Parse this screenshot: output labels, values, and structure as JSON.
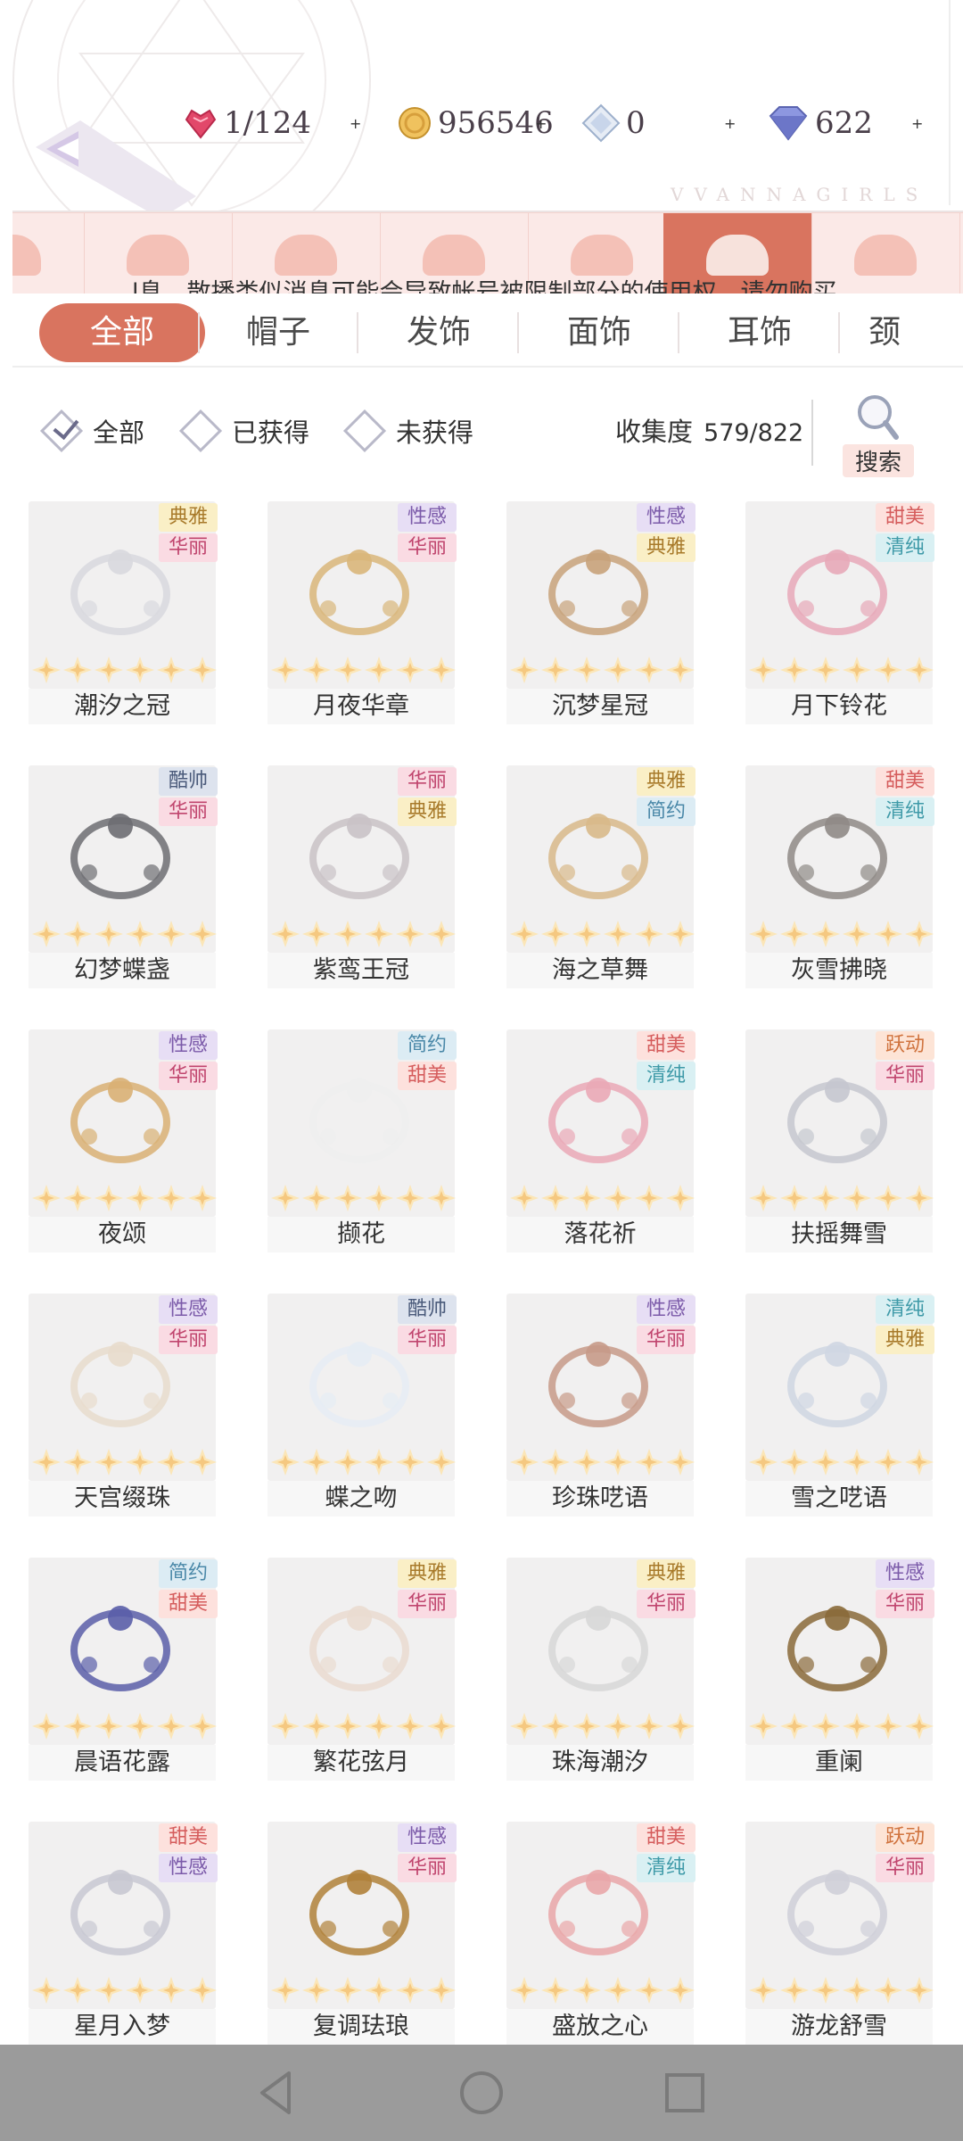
{
  "resources": [
    {
      "name": "stamina",
      "value": "1/124",
      "icon": "heart-gem-icon",
      "color": "#e2486a"
    },
    {
      "name": "gold",
      "value": "956546",
      "icon": "gold-coin-icon",
      "color": "#e9b650"
    },
    {
      "name": "crystal",
      "value": "0",
      "icon": "crystal-icon",
      "color": "#9db0cc"
    },
    {
      "name": "diamond",
      "value": "622",
      "icon": "diamond-icon",
      "color": "#6c76c8"
    }
  ],
  "plus_label": "+",
  "brand": "VVANNAGIRLS",
  "notice": "l息，散播类似消息可能会导致帐号被限制部分的使用权。请勿购买",
  "tabs": [
    "全部",
    "帽子",
    "发饰",
    "面饰",
    "耳饰",
    "颈"
  ],
  "filters": [
    "全部",
    "已获得",
    "未获得"
  ],
  "collection": {
    "label": "收集度",
    "value": "579/822"
  },
  "search_label": "搜索",
  "tag_colors": {
    "典雅": {
      "bg": "#faefc6",
      "fg": "#a87a2a"
    },
    "华丽": {
      "bg": "#fadbe3",
      "fg": "#c0456e"
    },
    "性感": {
      "bg": "#e7def5",
      "fg": "#7b5aa9"
    },
    "甜美": {
      "bg": "#fde1dd",
      "fg": "#d55c5c"
    },
    "清纯": {
      "bg": "#d9f0f3",
      "fg": "#3f9aa8"
    },
    "酷帅": {
      "bg": "#dde3ee",
      "fg": "#4a5a7a"
    },
    "简约": {
      "bg": "#dcecf4",
      "fg": "#4a88a8"
    },
    "跃动": {
      "bg": "#fde4d6",
      "fg": "#d0733e"
    }
  },
  "items": [
    {
      "name": "潮汐之冠",
      "tags": [
        "典雅",
        "华丽"
      ],
      "stars": 6
    },
    {
      "name": "月夜华章",
      "tags": [
        "性感",
        "华丽"
      ],
      "stars": 6
    },
    {
      "name": "沉梦星冠",
      "tags": [
        "性感",
        "典雅"
      ],
      "stars": 6
    },
    {
      "name": "月下铃花",
      "tags": [
        "甜美",
        "清纯"
      ],
      "stars": 6
    },
    {
      "name": "幻梦蝶盏",
      "tags": [
        "酷帅",
        "华丽"
      ],
      "stars": 6
    },
    {
      "name": "紫鸾王冠",
      "tags": [
        "华丽",
        "典雅"
      ],
      "stars": 6
    },
    {
      "name": "海之草舞",
      "tags": [
        "典雅",
        "简约"
      ],
      "stars": 6
    },
    {
      "name": "灰雪拂晓",
      "tags": [
        "甜美",
        "清纯"
      ],
      "stars": 6
    },
    {
      "name": "夜颂",
      "tags": [
        "性感",
        "华丽"
      ],
      "stars": 6
    },
    {
      "name": "撷花",
      "tags": [
        "简约",
        "甜美"
      ],
      "stars": 6
    },
    {
      "name": "落花祈",
      "tags": [
        "甜美",
        "清纯"
      ],
      "stars": 6
    },
    {
      "name": "扶摇舞雪",
      "tags": [
        "跃动",
        "华丽"
      ],
      "stars": 6
    },
    {
      "name": "天宫缀珠",
      "tags": [
        "性感",
        "华丽"
      ],
      "stars": 6
    },
    {
      "name": "蝶之吻",
      "tags": [
        "酷帅",
        "华丽"
      ],
      "stars": 6
    },
    {
      "name": "珍珠呓语",
      "tags": [
        "性感",
        "华丽"
      ],
      "stars": 6
    },
    {
      "name": "雪之呓语",
      "tags": [
        "清纯",
        "典雅"
      ],
      "stars": 6
    },
    {
      "name": "晨语花露",
      "tags": [
        "简约",
        "甜美"
      ],
      "stars": 6
    },
    {
      "name": "繁花弦月",
      "tags": [
        "典雅",
        "华丽"
      ],
      "stars": 6
    },
    {
      "name": "珠海潮汐",
      "tags": [
        "典雅",
        "华丽"
      ],
      "stars": 6
    },
    {
      "name": "重阑",
      "tags": [
        "性感",
        "华丽"
      ],
      "stars": 6
    },
    {
      "name": "星月入梦",
      "tags": [
        "甜美",
        "性感"
      ],
      "stars": 6
    },
    {
      "name": "复调珐琅",
      "tags": [
        "性感",
        "华丽"
      ],
      "stars": 6
    },
    {
      "name": "盛放之心",
      "tags": [
        "甜美",
        "清纯"
      ],
      "stars": 6
    },
    {
      "name": "游龙舒雪",
      "tags": [
        "跃动",
        "华丽"
      ],
      "stars": 6
    }
  ],
  "item_art_colors": [
    "#d8d8de",
    "#d9b67a",
    "#c8a27a",
    "#e7a8b8",
    "#6d6d72",
    "#c9c2c6",
    "#d8b98a",
    "#8f8a86",
    "#d9b074",
    "#eeeeee",
    "#eaa8b6",
    "#c5c7cf",
    "#e8dccc",
    "#e6ecf4",
    "#c79a88",
    "#cfd6e2",
    "#5a5ea8",
    "#eadbd0",
    "#d7d7d7",
    "#8a6a3a",
    "#c8c8d2",
    "#b0813a",
    "#e9a6a8",
    "#cfcfd8"
  ]
}
